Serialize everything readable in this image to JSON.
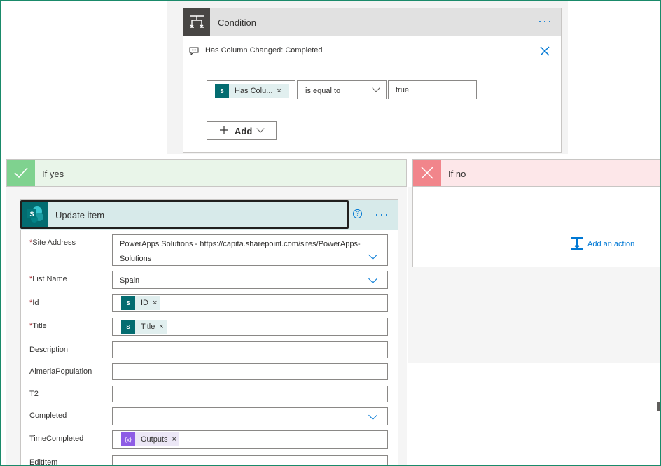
{
  "condition": {
    "title": "Condition",
    "more_label": "···",
    "comment": "Has Column Changed: Completed",
    "row": {
      "left_token": "Has Colu...",
      "operator": "is equal to",
      "right_value": "true"
    },
    "add_label": "Add"
  },
  "if_yes": {
    "label": "If yes",
    "color": "#e9f5e9",
    "accent": "#7fd28f"
  },
  "if_no": {
    "label": "If no",
    "color": "#fde7e9",
    "accent": "#f1858b",
    "add_action_label": "Add an action"
  },
  "update_item": {
    "title": "Update item",
    "help_label": "?",
    "more_label": "···",
    "fields": {
      "site_address": {
        "label": "Site Address",
        "value_line1": "PowerApps Solutions - https://capita.sharepoint.com/sites/PowerApps-",
        "value_line2": "Solutions"
      },
      "list_name": {
        "label": "List Name",
        "value": "Spain"
      },
      "id": {
        "label": "Id",
        "token": "ID"
      },
      "title": {
        "label": "Title",
        "token": "Title"
      },
      "description": {
        "label": "Description"
      },
      "almeria_population": {
        "label": "AlmeriaPopulation"
      },
      "t2": {
        "label": "T2"
      },
      "completed": {
        "label": "Completed"
      },
      "time_completed": {
        "label": "TimeCompleted",
        "token": "Outputs"
      },
      "edit_item": {
        "label": "EditItem"
      }
    },
    "required_mark": "*",
    "sp_icon_text": "S",
    "expr_icon_text": "{x}",
    "remove_mark": "×"
  }
}
